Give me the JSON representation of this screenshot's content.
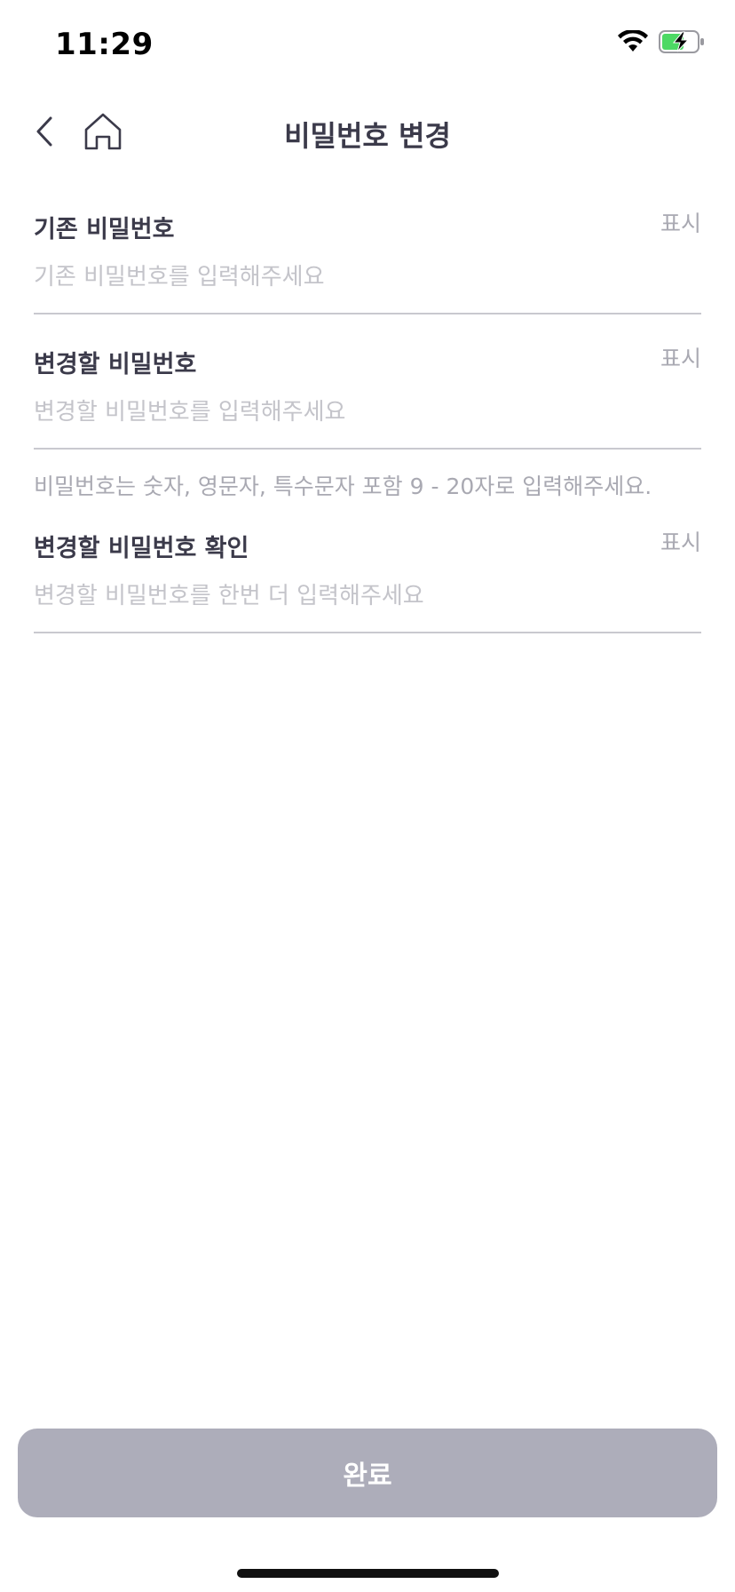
{
  "status_bar": {
    "time": "11:29"
  },
  "nav": {
    "title": "비밀번호 변경"
  },
  "form": {
    "current_password": {
      "label": "기존 비밀번호",
      "show_label": "표시",
      "placeholder": "기존 비밀번호를 입력해주세요"
    },
    "new_password": {
      "label": "변경할 비밀번호",
      "show_label": "표시",
      "placeholder": "변경할 비밀번호를 입력해주세요",
      "hint": "비밀번호는 숫자, 영문자, 특수문자 포함 9 - 20자로 입력해주세요."
    },
    "confirm_password": {
      "label": "변경할 비밀번호 확인",
      "show_label": "표시",
      "placeholder": "변경할 비밀번호를 한번 더 입력해주세요"
    }
  },
  "submit": {
    "label": "완료"
  },
  "colors": {
    "text_primary": "#3b3a4a",
    "text_muted": "#a9a9b2",
    "placeholder": "#c4c4ca",
    "button_disabled": "#adadba",
    "battery_green": "#4cd964"
  },
  "icons": {
    "back": "chevron-left-icon",
    "home": "home-icon",
    "wifi": "wifi-icon",
    "battery": "battery-charging-icon"
  }
}
